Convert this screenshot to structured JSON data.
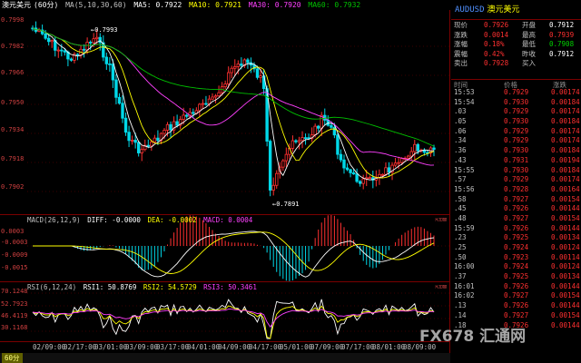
{
  "main_header": {
    "symbol": "澳元美元",
    "period": "(60分)",
    "ma_params": "MA(5,10,30,60)",
    "ma5": "MA5: 0.7922",
    "ma10": "MA10: 0.7921",
    "ma30": "MA30: 0.7920",
    "ma60": "MA60: 0.7932"
  },
  "main_axis": [
    "0.7998",
    "0.7982",
    "0.7966",
    "0.7950",
    "0.7934",
    "0.7918",
    "0.7902"
  ],
  "annotations": {
    "high": "0.7993",
    "low": "0.7891"
  },
  "macd_header": {
    "name": "MACD(26,12,9)",
    "diff": "DIFF: -0.0000",
    "dea": "DEA: -0.0002",
    "macd": "MACD: 0.0004"
  },
  "macd_axis": [
    "0.0003",
    "-0.0003",
    "-0.0009",
    "-0.0015"
  ],
  "rsi_header": {
    "name": "RSI(6,12,24)",
    "rsi1": "RSI1: 50.8769",
    "rsi2": "RSI2: 54.5729",
    "rsi3": "RSI3: 50.3461"
  },
  "rsi_axis": [
    "70.1248",
    "52.7923",
    "46.4119",
    "30.1168"
  ],
  "x_axis": [
    "02/09:00",
    "02/17:00",
    "03/01:00",
    "03/09:00",
    "03/17:00",
    "04/01:00",
    "04/09:00",
    "04/17:00",
    "05/01:00",
    "07/09:00",
    "07/17:00",
    "08/01:00",
    "08/09:00"
  ],
  "period_tab": "60分",
  "win_ctl": "⇱⊡⊠",
  "quote": {
    "symbol": "AUDUSD",
    "name": "澳元美元",
    "rows": [
      {
        "l1": "现价",
        "v1": "0.7926",
        "l2": "开盘",
        "v2": "0.7912"
      },
      {
        "l1": "涨跌",
        "v1": "0.0014",
        "l2": "最高",
        "v2": "0.7939"
      },
      {
        "l1": "涨幅",
        "v1": "0.18%",
        "l2": "最低",
        "v2": "0.7908"
      },
      {
        "l1": "震幅",
        "v1": "0.42%",
        "l2": "昨收",
        "v2": "0.7912"
      },
      {
        "l1": "卖出",
        "v1": "0.7928",
        "l2": "买入",
        "v2": ""
      }
    ],
    "tick_headers": {
      "time": "时间",
      "price": "价格",
      "change": "涨跌"
    },
    "ticks": [
      {
        "t": "15:53",
        "p": "0.7929",
        "c": "0.00174"
      },
      {
        "t": "15:54",
        "p": "0.7930",
        "c": "0.00184"
      },
      {
        "t": ".03",
        "p": "0.7929",
        "c": "0.00174"
      },
      {
        "t": ".05",
        "p": "0.7930",
        "c": "0.00184"
      },
      {
        "t": ".06",
        "p": "0.7929",
        "c": "0.00174"
      },
      {
        "t": ".34",
        "p": "0.7929",
        "c": "0.00174"
      },
      {
        "t": ".36",
        "p": "0.7930",
        "c": "0.00184"
      },
      {
        "t": ".43",
        "p": "0.7931",
        "c": "0.00194"
      },
      {
        "t": "15:55",
        "p": "0.7930",
        "c": "0.00184"
      },
      {
        "t": ".57",
        "p": "0.7929",
        "c": "0.00174"
      },
      {
        "t": "15:56",
        "p": "0.7928",
        "c": "0.00164"
      },
      {
        "t": ".58",
        "p": "0.7927",
        "c": "0.00154"
      },
      {
        "t": ".45",
        "p": "0.7926",
        "c": "0.00144"
      },
      {
        "t": ".48",
        "p": "0.7927",
        "c": "0.00154"
      },
      {
        "t": "15:59",
        "p": "0.7926",
        "c": "0.00144"
      },
      {
        "t": ".23",
        "p": "0.7925",
        "c": "0.00134"
      },
      {
        "t": ".25",
        "p": "0.7924",
        "c": "0.00124"
      },
      {
        "t": ".50",
        "p": "0.7923",
        "c": "0.00114"
      },
      {
        "t": "16:00",
        "p": "0.7924",
        "c": "0.00124"
      },
      {
        "t": ".37",
        "p": "0.7925",
        "c": "0.00134"
      },
      {
        "t": "16:01",
        "p": "0.7926",
        "c": "0.00144"
      },
      {
        "t": "16:02",
        "p": "0.7927",
        "c": "0.00154"
      },
      {
        "t": ".13",
        "p": "0.7926",
        "c": "0.00144"
      },
      {
        "t": ".14",
        "p": "0.7927",
        "c": "0.00154"
      },
      {
        "t": ".18",
        "p": "0.7926",
        "c": "0.00144"
      }
    ]
  },
  "watermark": "FX678 汇通网",
  "colors": {
    "up": "#ff3030",
    "down": "#00d8e8",
    "ma5": "#ffffff",
    "ma10": "#ffff00",
    "ma30": "#ff40ff",
    "ma60": "#00c000",
    "label": "#d04040"
  }
}
